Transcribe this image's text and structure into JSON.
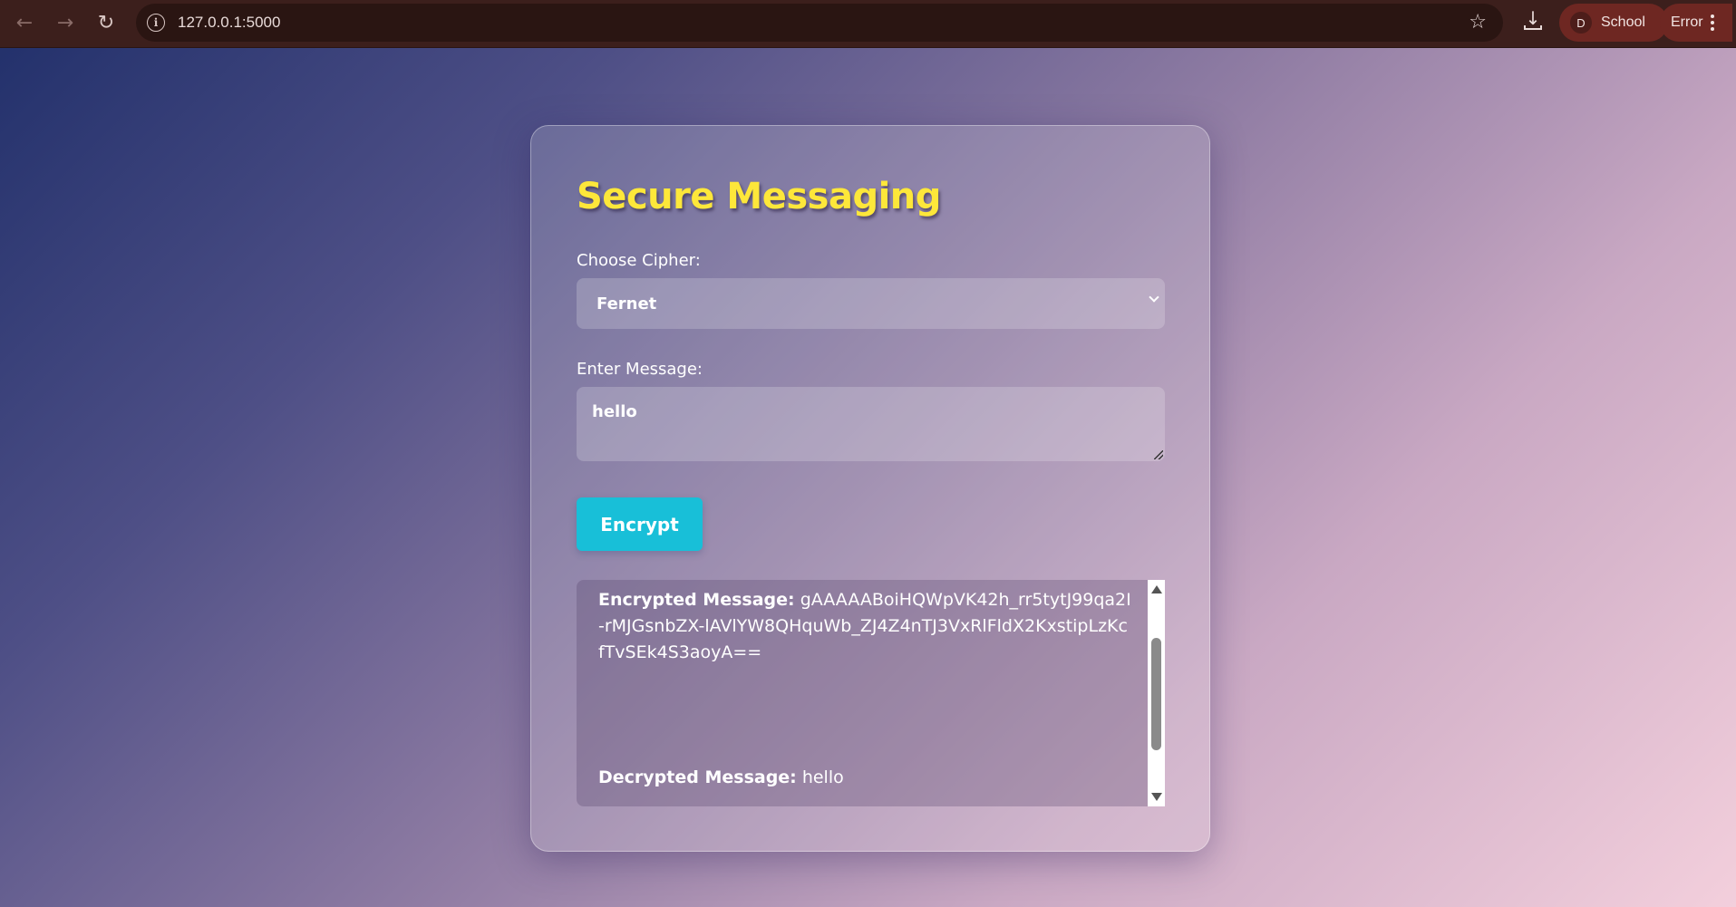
{
  "browser": {
    "url": "127.0.0.1:5000",
    "profile_initial": "D",
    "profile_name": "School",
    "error_label": "Error"
  },
  "page": {
    "title": "Secure Messaging",
    "cipher_label": "Choose Cipher:",
    "cipher_value": "Fernet",
    "message_label": "Enter Message:",
    "message_value": "hello",
    "encrypt_label": "Encrypt",
    "encrypted_label": "Encrypted Message:",
    "encrypted_value": "gAAAAABoiHQWpVK42h_rr5tytJ99qa2I-rMJGsnbZX-lAVlYW8QHquWb_ZJ4Z4nTJ3VxRlFldX2KxstipLzKcfTvSEk4S3aoyA==",
    "decrypted_label": "Decrypted Message:",
    "decrypted_value": "hello"
  },
  "colors": {
    "title": "#fde73a",
    "button": "#18bfd8",
    "chrome": "#3c1f1c"
  }
}
